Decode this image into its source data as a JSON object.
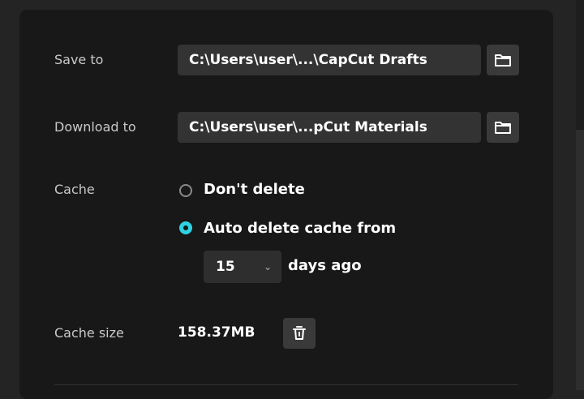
{
  "settings": {
    "save_to": {
      "label": "Save to",
      "path": "C:\\Users\\user\\...\\CapCut Drafts",
      "browse_icon": "folder-icon"
    },
    "download_to": {
      "label": "Download to",
      "path": "C:\\Users\\user\\...pCut Materials",
      "browse_icon": "folder-icon"
    },
    "cache": {
      "label": "Cache",
      "options": [
        {
          "label": "Don't delete",
          "selected": false
        },
        {
          "label": "Auto delete cache from",
          "selected": true
        }
      ],
      "days_value": "15",
      "days_suffix": "days ago"
    },
    "cache_size": {
      "label": "Cache size",
      "value": "158.37MB",
      "clear_icon": "trash-icon"
    }
  },
  "colors": {
    "accent": "#2fd2e3",
    "panel": "#181818",
    "background": "#242424"
  }
}
